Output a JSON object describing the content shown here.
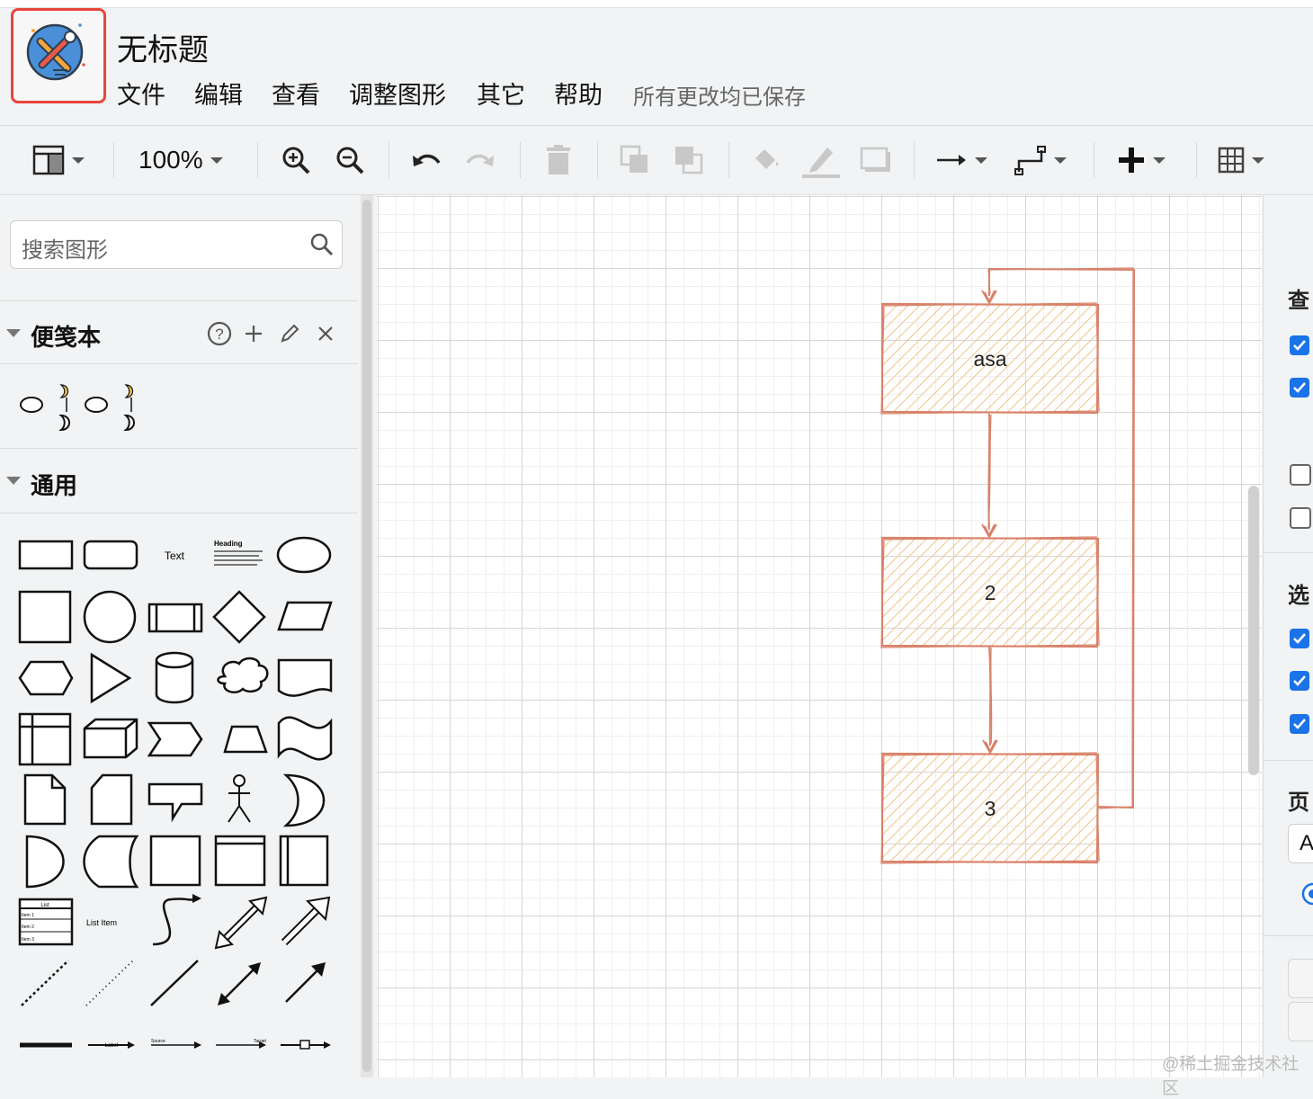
{
  "app": {
    "title": "无标题",
    "menu": [
      "文件",
      "编辑",
      "查看",
      "调整图形",
      "其它",
      "帮助"
    ],
    "save_status": "所有更改均已保存"
  },
  "toolbar": {
    "zoom": "100%",
    "icons": [
      "format-panel-icon",
      "zoom-in-icon",
      "zoom-out-icon",
      "undo-icon",
      "redo-icon",
      "delete-icon",
      "to-front-icon",
      "to-back-icon",
      "fill-color-icon",
      "line-color-icon",
      "shadow-icon",
      "connection-icon",
      "waypoints-icon",
      "insert-icon",
      "table-icon"
    ]
  },
  "sidebar": {
    "search_placeholder": "搜索图形",
    "scratchpad": {
      "title": "便笺本"
    },
    "general": {
      "title": "通用",
      "text_shape_label": "Text",
      "heading_shape_title": "Heading",
      "heading_shape_body": "Lorem ipsum dolor sit amet, consectetur adipisicing elit, sed do eiusmod tempor incididunt ut labore et dolore magna aliqua.",
      "list_title": "List",
      "list_items": [
        "Item 1",
        "Item 2",
        "Item 3"
      ],
      "list_item_label": "List Item",
      "edge_label": "Label",
      "edge_source": "Source",
      "edge_target": "Target"
    }
  },
  "diagram": {
    "nodes": [
      {
        "id": "n1",
        "label": "asa"
      },
      {
        "id": "n2",
        "label": "2"
      },
      {
        "id": "n3",
        "label": "3"
      }
    ],
    "style": {
      "stroke": "#d9826a",
      "fill": "#f3c78f",
      "sketch": true
    }
  },
  "right_panel": {
    "sections": [
      "查看",
      "选项",
      "页面"
    ],
    "page_size_letter": "A",
    "checkboxes": [
      true,
      true,
      false,
      false,
      true,
      true,
      true
    ]
  },
  "watermark": "@稀土掘金技术社区"
}
